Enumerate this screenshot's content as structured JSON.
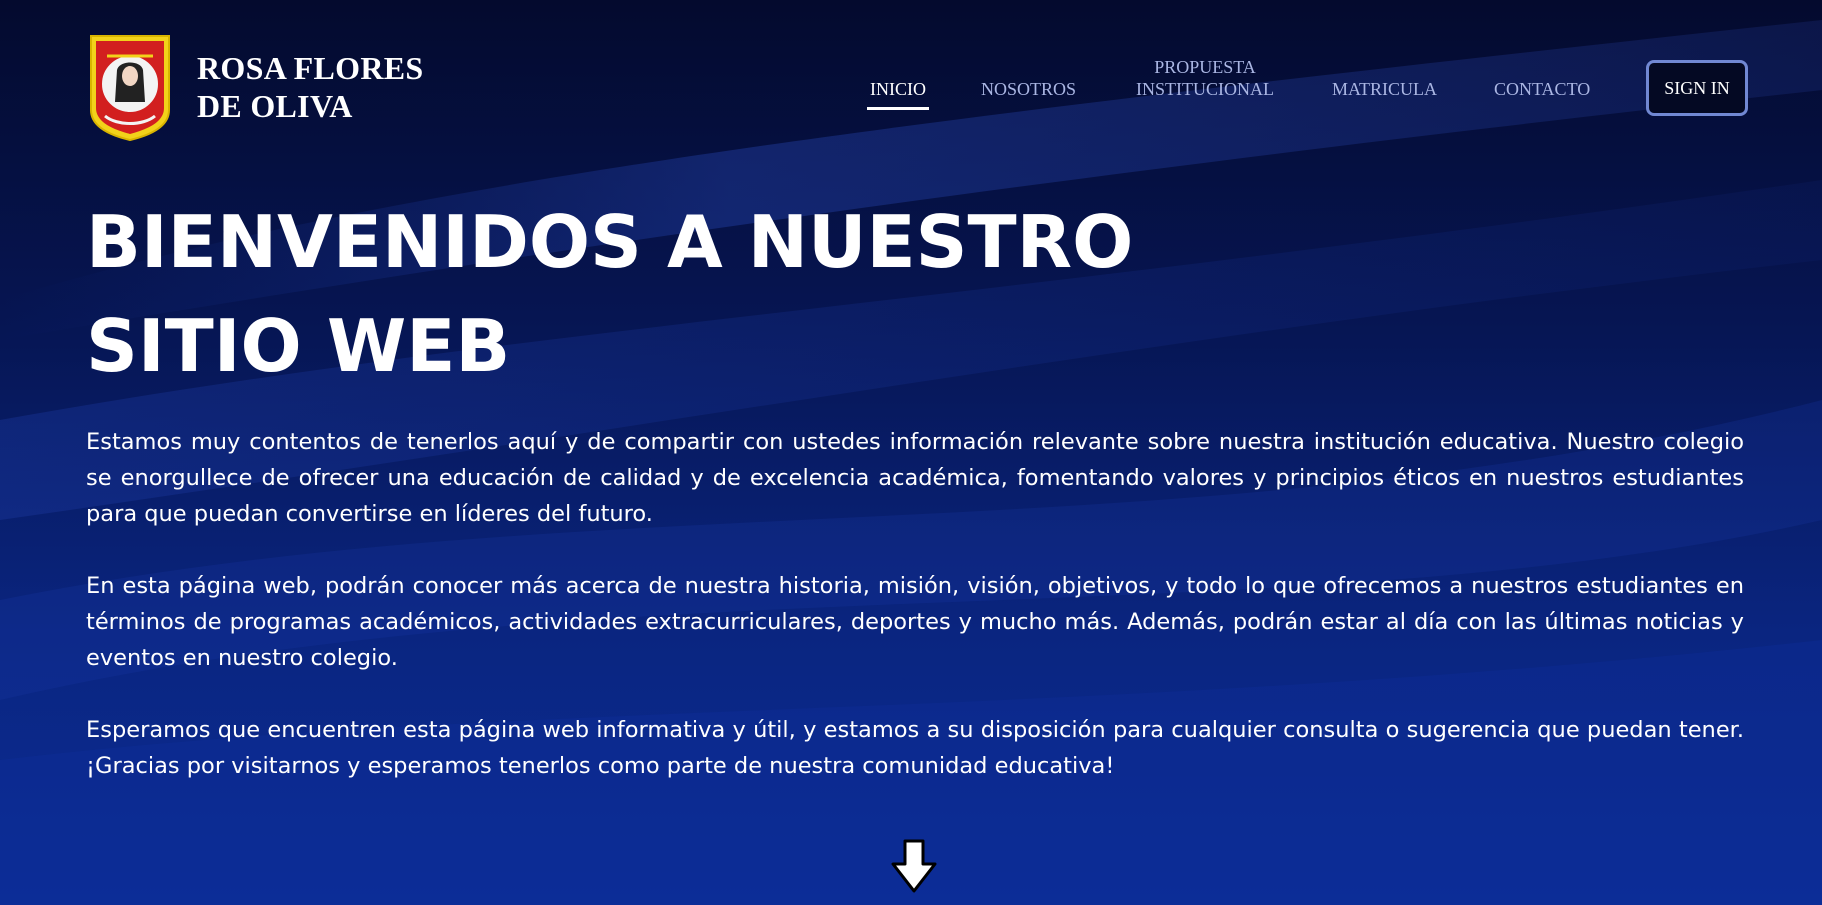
{
  "brand": {
    "name_line1": "ROSA FLORES",
    "name_line2": "DE OLIVA",
    "logo_icon": "school-crest-icon"
  },
  "nav": {
    "items": [
      {
        "label": "INICIO",
        "active": true
      },
      {
        "label": "NOSOTROS",
        "active": false
      },
      {
        "label_line1": "PROPUESTA",
        "label_line2": "INSTITUCIONAL",
        "active": false
      },
      {
        "label": "MATRICULA",
        "active": false
      },
      {
        "label": "CONTACTO",
        "active": false
      }
    ],
    "signin_label": "SIGN IN"
  },
  "hero": {
    "title_line1": "BIENVENIDOS A NUESTRO",
    "title_line2": "SITIO WEB",
    "paragraphs": [
      "Estamos muy contentos de tenerlos aquí y de compartir con ustedes información relevante sobre nuestra institución educativa. Nuestro colegio se enorgullece de ofrecer una educación de calidad y de excelencia académica, fomentando valores y principios éticos en nuestros estudiantes para que puedan convertirse en líderes del futuro.",
      "En esta página web, podrán conocer más acerca de nuestra historia, misión, visión, objetivos, y todo lo que ofrecemos a nuestros estudiantes en términos de programas académicos, actividades extracurriculares, deportes y mucho más. Además, podrán estar al día con las últimas noticias y eventos en nuestro colegio.",
      "Esperamos que encuentren esta página web informativa y útil, y estamos a su disposición para cualquier consulta o sugerencia que puedan tener. ¡Gracias por visitarnos y esperamos tenerlos como parte de nuestra comunidad educativa!"
    ],
    "scroll_icon": "arrow-down-icon"
  },
  "colors": {
    "background_dark": "#040a2e",
    "background_mid": "#0b2a8a",
    "nav_text": "#aab6e3",
    "signin_border": "#7188d3"
  }
}
